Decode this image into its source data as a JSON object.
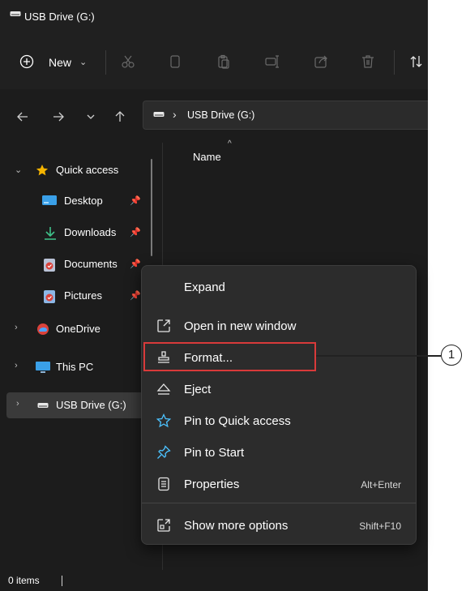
{
  "titlebar": {
    "title": "USB Drive (G:)"
  },
  "toolbar": {
    "new_label": "New"
  },
  "address": {
    "path": "USB Drive (G:)"
  },
  "columns": {
    "name": "Name"
  },
  "sidebar": {
    "items": [
      {
        "label": "Quick access"
      },
      {
        "label": "Desktop"
      },
      {
        "label": "Downloads"
      },
      {
        "label": "Documents"
      },
      {
        "label": "Pictures"
      },
      {
        "label": "OneDrive"
      },
      {
        "label": "This PC"
      },
      {
        "label": "USB Drive (G:)"
      }
    ]
  },
  "context_menu": {
    "items": [
      {
        "label": "Expand",
        "shortcut": ""
      },
      {
        "label": "Open in new window",
        "shortcut": ""
      },
      {
        "label": "Format...",
        "shortcut": ""
      },
      {
        "label": "Eject",
        "shortcut": ""
      },
      {
        "label": "Pin to Quick access",
        "shortcut": ""
      },
      {
        "label": "Pin to Start",
        "shortcut": ""
      },
      {
        "label": "Properties",
        "shortcut": "Alt+Enter"
      },
      {
        "label": "Show more options",
        "shortcut": "Shift+F10"
      }
    ]
  },
  "status": {
    "items": "0 items"
  },
  "callout": {
    "number": "1"
  },
  "colors": {
    "highlight": "#d93a3a",
    "accent": "#4cc2ff",
    "background": "#1c1c1c",
    "menu": "#2c2c2c"
  }
}
